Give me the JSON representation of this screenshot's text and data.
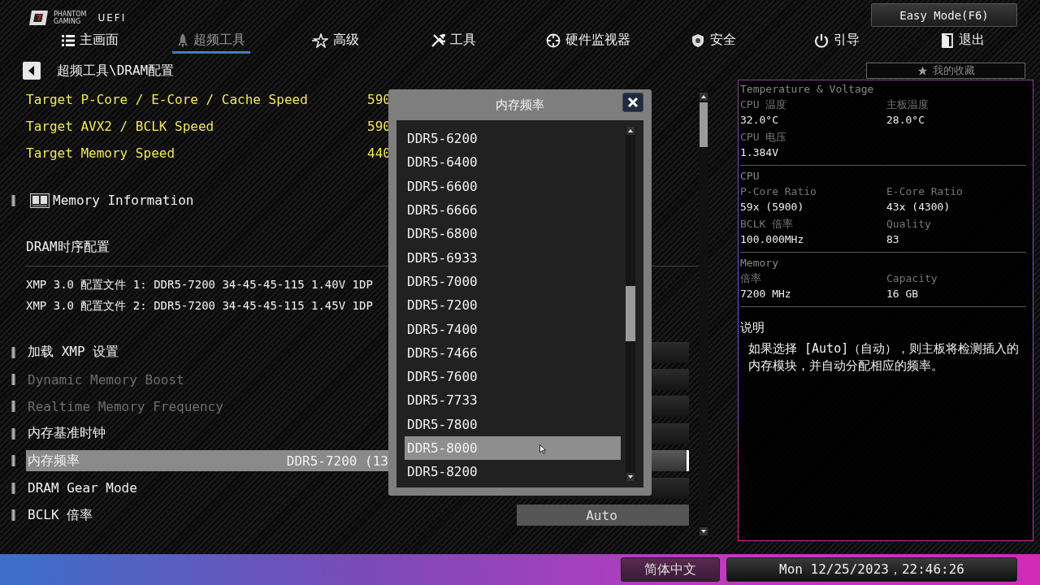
{
  "logo": {
    "brand_top": "PHANTOM",
    "brand_bottom": "GAMING",
    "product": "UEFI"
  },
  "easy_mode_button": "Easy Mode(F6)",
  "tabs": [
    {
      "label": "主画面",
      "selected": false
    },
    {
      "label": "超频工具",
      "selected": true
    },
    {
      "label": "高级",
      "selected": false
    },
    {
      "label": "工具",
      "selected": false
    },
    {
      "label": "硬件监视器",
      "selected": false
    },
    {
      "label": "安全",
      "selected": false
    },
    {
      "label": "引导",
      "selected": false
    },
    {
      "label": "退出",
      "selected": false
    }
  ],
  "breadcrumb": "超频工具\\DRAM配置",
  "favorites": "我的收藏",
  "rows": [
    {
      "kind": "info",
      "label": "Target P-Core / E-Core / Cache Speed",
      "value": "590"
    },
    {
      "kind": "info",
      "label": "Target AVX2 / BCLK Speed",
      "value": "590"
    },
    {
      "kind": "info",
      "label": "Target Memory Speed",
      "value": "440"
    },
    {
      "kind": "section",
      "label": "Memory Information"
    },
    {
      "kind": "heading",
      "label": "DRAM时序配置"
    },
    {
      "kind": "text",
      "label": "XMP 3.0 配置文件 1: DDR5-7200 34-45-45-115 1.40V 1DP"
    },
    {
      "kind": "text",
      "label": "XMP 3.0 配置文件 2: DDR5-7200 34-45-45-115 1.45V 1DP"
    },
    {
      "kind": "setting",
      "label": "加载 XMP 设置",
      "disabled": false,
      "selected": false
    },
    {
      "kind": "setting",
      "label": "Dynamic Memory Boost",
      "disabled": true,
      "selected": false
    },
    {
      "kind": "setting",
      "label": "Realtime Memory Frequency",
      "disabled": true,
      "selected": false
    },
    {
      "kind": "setting",
      "label": "内存基准时钟",
      "disabled": false,
      "selected": false
    },
    {
      "kind": "setting",
      "label": "内存频率",
      "value": "DDR5-7200 (13",
      "disabled": false,
      "selected": true
    },
    {
      "kind": "setting",
      "label": "DRAM Gear Mode",
      "disabled": false,
      "selected": false
    },
    {
      "kind": "setting",
      "label": "BCLK 倍率",
      "button": "Auto",
      "disabled": false,
      "selected": false
    }
  ],
  "info_panel": {
    "sections": [
      {
        "title": "Temperature & Voltage",
        "items": [
          {
            "label": "CPU 温度",
            "value": "32.0°C"
          },
          {
            "label": "主板温度",
            "value": "28.0°C"
          },
          {
            "label": "CPU 电压",
            "value": "1.384V"
          }
        ]
      },
      {
        "title": "CPU",
        "items": [
          {
            "label": "P-Core Ratio",
            "value": "59x (5900)"
          },
          {
            "label": "E-Core Ratio",
            "value": "43x (4300)"
          },
          {
            "label": "BCLK 倍率",
            "value": "100.000MHz"
          },
          {
            "label": "Quality",
            "value": "83"
          }
        ]
      },
      {
        "title": "Memory",
        "items": [
          {
            "label": "倍率",
            "value": "7200 MHz"
          },
          {
            "label": "Capacity",
            "value": "16 GB"
          }
        ]
      }
    ],
    "description": {
      "title": "说明",
      "text": "如果选择 [Auto]（自动），则主板将检测插入的内存模块，并自动分配相应的频率。"
    }
  },
  "dialog": {
    "title": "内存频率",
    "options": [
      {
        "label": "DDR5-6200",
        "selected": false
      },
      {
        "label": "DDR5-6400",
        "selected": false
      },
      {
        "label": "DDR5-6600",
        "selected": false
      },
      {
        "label": "DDR5-6666",
        "selected": false
      },
      {
        "label": "DDR5-6800",
        "selected": false
      },
      {
        "label": "DDR5-6933",
        "selected": false
      },
      {
        "label": "DDR5-7000",
        "selected": false
      },
      {
        "label": "DDR5-7200",
        "selected": false
      },
      {
        "label": "DDR5-7400",
        "selected": false
      },
      {
        "label": "DDR5-7466",
        "selected": false
      },
      {
        "label": "DDR5-7600",
        "selected": false
      },
      {
        "label": "DDR5-7733",
        "selected": false
      },
      {
        "label": "DDR5-7800",
        "selected": false
      },
      {
        "label": "DDR5-8000",
        "selected": true
      },
      {
        "label": "DDR5-8200",
        "selected": false
      }
    ]
  },
  "status_bar": {
    "language": "简体中文",
    "datetime": "Mon 12/25/2023，22:46:26"
  }
}
